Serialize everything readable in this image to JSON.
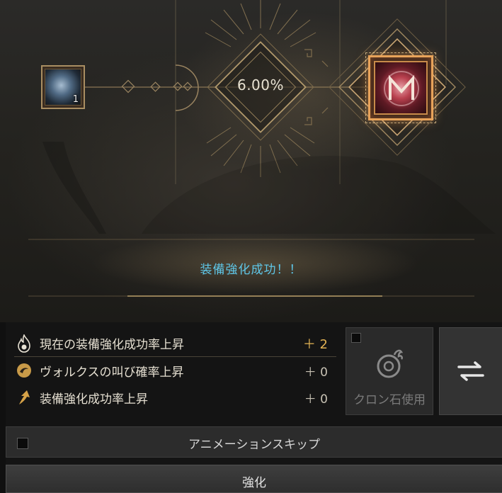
{
  "rate": {
    "value": "6.00%"
  },
  "material": {
    "count": "1",
    "icon": "black-stone-icon"
  },
  "result": {
    "icon": "enhanced-equipment-icon"
  },
  "message": {
    "success": "装備強化成功！！"
  },
  "stats": [
    {
      "label": "現在の装備強化成功率上昇",
      "value": "＋ 2",
      "icon": "flame-icon"
    },
    {
      "label": "ヴォルクスの叫び確率上昇",
      "value": "＋ 0",
      "icon": "valks-cry-icon"
    },
    {
      "label": "装備強化成功率上昇",
      "value": "＋ 0",
      "icon": "up-arrow-icon"
    }
  ],
  "cron": {
    "label": "クロン石使用",
    "icon": "cron-stone-icon"
  },
  "swap": {
    "icon": "swap-arrows-icon"
  },
  "skip": {
    "label": "アニメーションスキップ"
  },
  "enhance": {
    "label": "強化"
  },
  "colors": {
    "accent_gold": "#e3b354",
    "message_blue": "#5fc7e8",
    "frame_orange": "#e8a35a"
  }
}
